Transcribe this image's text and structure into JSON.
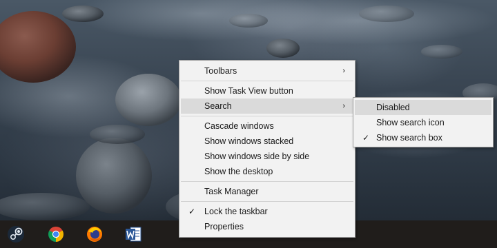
{
  "context_menu": {
    "items": [
      {
        "label": "Toolbars",
        "submenu_arrow": "›"
      },
      {
        "label": "Show Task View button"
      },
      {
        "label": "Search",
        "submenu_arrow": "›"
      },
      {
        "label": "Cascade windows"
      },
      {
        "label": "Show windows stacked"
      },
      {
        "label": "Show windows side by side"
      },
      {
        "label": "Show the desktop"
      },
      {
        "label": "Task Manager"
      },
      {
        "label": "Lock the taskbar",
        "check": "✓"
      },
      {
        "label": "Properties"
      }
    ]
  },
  "search_submenu": {
    "items": [
      {
        "label": "Disabled"
      },
      {
        "label": "Show search icon"
      },
      {
        "label": "Show search box",
        "check": "✓"
      }
    ]
  },
  "taskbar": {
    "icons": [
      "steam-icon",
      "chrome-icon",
      "firefox-icon",
      "word-icon"
    ]
  },
  "colors": {
    "taskbar_bg": "#201d1b",
    "menu_bg": "#f2f2f2",
    "menu_highlight": "#dadada",
    "word_blue": "#2b5797"
  }
}
